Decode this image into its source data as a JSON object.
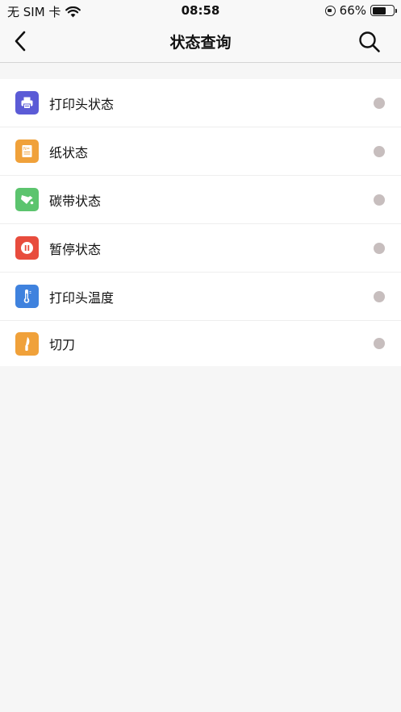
{
  "status_bar": {
    "carrier": "无 SIM 卡",
    "time": "08:58",
    "battery": "66%",
    "battery_level": 0.66
  },
  "nav": {
    "title": "状态查询"
  },
  "items": [
    {
      "label": "打印头状态",
      "icon": "printer-icon",
      "color": "#5b5bd6"
    },
    {
      "label": "纸状态",
      "icon": "paper-icon",
      "color": "#f0a13a"
    },
    {
      "label": "碳带状态",
      "icon": "ribbon-icon",
      "color": "#5cc46e"
    },
    {
      "label": "暂停状态",
      "icon": "pause-icon",
      "color": "#e84c3d"
    },
    {
      "label": "打印头温度",
      "icon": "thermometer-icon",
      "color": "#3f82de"
    },
    {
      "label": "切刀",
      "icon": "cutter-icon",
      "color": "#f0a13a"
    }
  ],
  "status_dot_color": "#c7bebe"
}
